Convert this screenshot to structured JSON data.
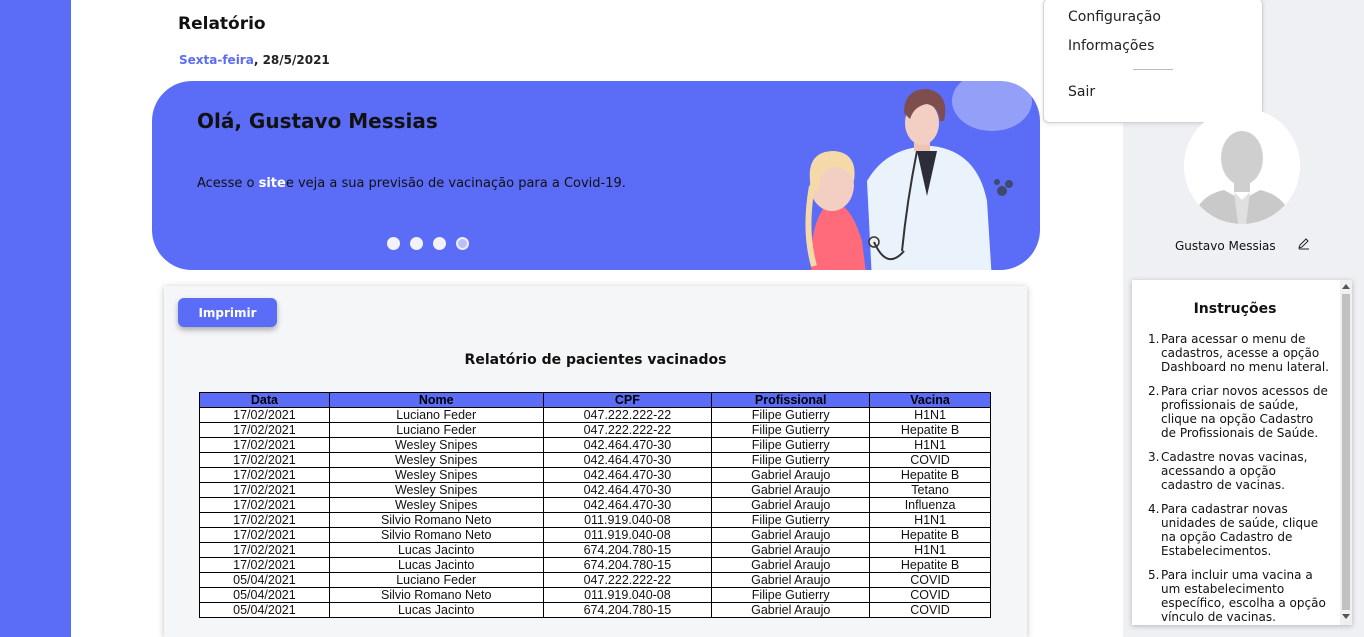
{
  "page": {
    "title": "Relatório",
    "weekday": "Sexta-feira",
    "date": ", 28/5/2021"
  },
  "sidebar": {
    "items": [
      {
        "icon": "chevron-right-icon"
      },
      {
        "icon": "dashboard-icon"
      },
      {
        "icon": "report-icon"
      },
      {
        "icon": "logout-icon"
      }
    ]
  },
  "banner": {
    "greeting": "Olá, Gustavo Messias",
    "text_before": "Acesse o ",
    "link": "site",
    "text_after": "e veja a sua previsão de vacinação para a Covid-19.",
    "slides": 4,
    "active_slide": 4
  },
  "report": {
    "print_label": "Imprimir",
    "title": "Relatório de pacientes vacinados",
    "columns": [
      "Data",
      "Nome",
      "CPF",
      "Profissional",
      "Vacina"
    ],
    "rows": [
      [
        "17/02/2021",
        "Luciano Feder",
        "047.222.222-22",
        "Filipe Gutierry",
        "H1N1"
      ],
      [
        "17/02/2021",
        "Luciano Feder",
        "047.222.222-22",
        "Filipe Gutierry",
        "Hepatite B"
      ],
      [
        "17/02/2021",
        "Wesley Snipes",
        "042.464.470-30",
        "Filipe Gutierry",
        "H1N1"
      ],
      [
        "17/02/2021",
        "Wesley Snipes",
        "042.464.470-30",
        "Filipe Gutierry",
        "COVID"
      ],
      [
        "17/02/2021",
        "Wesley Snipes",
        "042.464.470-30",
        "Gabriel Araujo",
        "Hepatite B"
      ],
      [
        "17/02/2021",
        "Wesley Snipes",
        "042.464.470-30",
        "Gabriel Araujo",
        "Tetano"
      ],
      [
        "17/02/2021",
        "Wesley Snipes",
        "042.464.470-30",
        "Gabriel Araujo",
        "Influenza"
      ],
      [
        "17/02/2021",
        "Silvio Romano Neto",
        "011.919.040-08",
        "Filipe Gutierry",
        "H1N1"
      ],
      [
        "17/02/2021",
        "Silvio Romano Neto",
        "011.919.040-08",
        "Gabriel Araujo",
        "Hepatite B"
      ],
      [
        "17/02/2021",
        "Lucas Jacinto",
        "674.204.780-15",
        "Gabriel Araujo",
        "H1N1"
      ],
      [
        "17/02/2021",
        "Lucas Jacinto",
        "674.204.780-15",
        "Gabriel Araujo",
        "Hepatite B"
      ],
      [
        "05/04/2021",
        "Luciano Feder",
        "047.222.222-22",
        "Gabriel Araujo",
        "COVID"
      ],
      [
        "05/04/2021",
        "Silvio Romano Neto",
        "011.919.040-08",
        "Filipe Gutierry",
        "COVID"
      ],
      [
        "05/04/2021",
        "Lucas Jacinto",
        "674.204.780-15",
        "Gabriel Araujo",
        "COVID"
      ]
    ]
  },
  "menu": {
    "items": [
      "Configuração",
      "Informações",
      "Sair"
    ]
  },
  "profile": {
    "name": "Gustavo Messias"
  },
  "instructions": {
    "title": "Instruções",
    "items": [
      "Para acessar o menu de cadastros, acesse a opção Dashboard no menu lateral.",
      "Para criar novos acessos de profissionais de saúde, clique na opção Cadastro de Profissionais de Saúde.",
      "Cadastre novas vacinas, acessando a opção cadastro de vacinas.",
      "Para cadastrar novas unidades de saúde, clique na opção Cadastro de Estabelecimentos.",
      "Para incluir uma vacina a um estabelecimento específico, escolha a opção vínculo de vacinas."
    ]
  },
  "colors": {
    "accent": "#5b6cf6",
    "sidebar": "#5b6cf6"
  }
}
